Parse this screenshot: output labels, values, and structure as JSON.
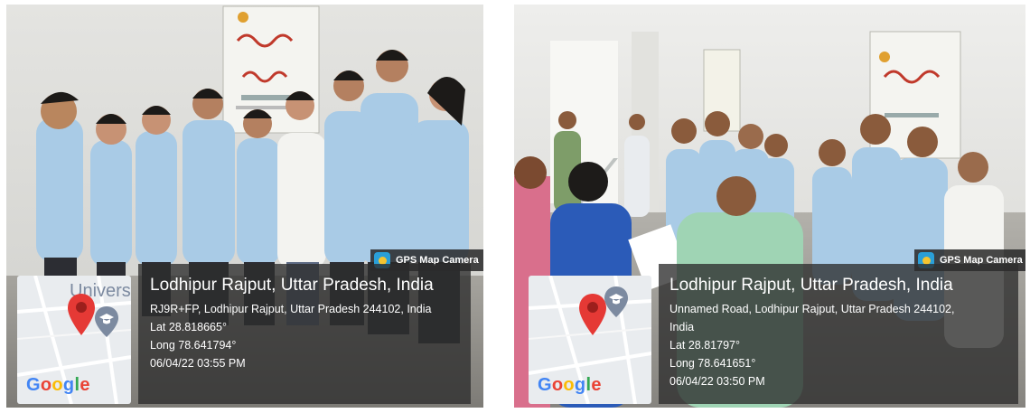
{
  "photos": [
    {
      "badge": "GPS Map Camera",
      "map_label": "University",
      "google": "Google",
      "title": "Lodhipur Rajput, Uttar Pradesh, India",
      "address": "RJ9R+FP, Lodhipur Rajput, Uttar Pradesh 244102, India",
      "address2": "",
      "lat": "Lat 28.818665°",
      "long": "Long 78.641794°",
      "datetime": "06/04/22 03:55 PM"
    },
    {
      "badge": "GPS Map Camera",
      "map_label": "",
      "google": "Google",
      "title": "Lodhipur Rajput, Uttar Pradesh, India",
      "address": "Unnamed Road, Lodhipur Rajput, Uttar Pradesh 244102,",
      "address2": "India",
      "lat": "Lat 28.81797°",
      "long": "Long 78.641651°",
      "datetime": "06/04/22 03:50 PM"
    }
  ],
  "colors": {
    "shirt": "#a9cbe6",
    "trousers": "#2c2d33",
    "wall": "#dcdcd8",
    "pin": "#e53935",
    "overlay": "#2d2d2d"
  }
}
